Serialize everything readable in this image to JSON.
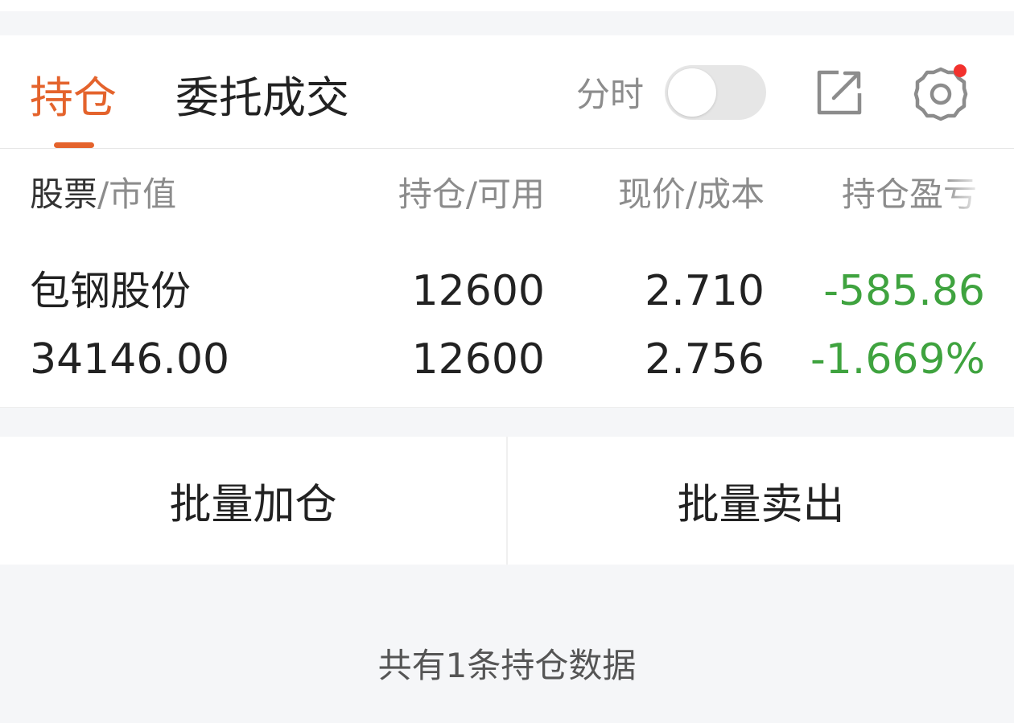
{
  "tabs": {
    "holdings": "持仓",
    "orders": "委托成交"
  },
  "toolbar": {
    "timeshare_label": "分时",
    "timeshare_toggle_on": false,
    "share_icon": "external-link-icon",
    "settings_icon": "gear-icon",
    "settings_has_notice": true,
    "notice_color": "#f2312d"
  },
  "table": {
    "headers": {
      "stock": "股票",
      "separator": "/",
      "market_value": "市值",
      "qty": "持仓/可用",
      "price": "现价/成本",
      "pnl": "持仓盈亏"
    },
    "rows": [
      {
        "name": "包钢股份",
        "market_value": "34146.00",
        "position": "12600",
        "available": "12600",
        "current_price": "2.710",
        "cost": "2.756",
        "pnl": "-585.86",
        "pnl_pct": "-1.669%"
      }
    ]
  },
  "actions": {
    "batch_add": "批量加仓",
    "batch_sell": "批量卖出"
  },
  "summary": "共有1条持仓数据",
  "colors": {
    "accent": "#e4632c",
    "loss": "#3fa33f",
    "muted": "#8c8c8c",
    "background": "#f5f6f8"
  }
}
